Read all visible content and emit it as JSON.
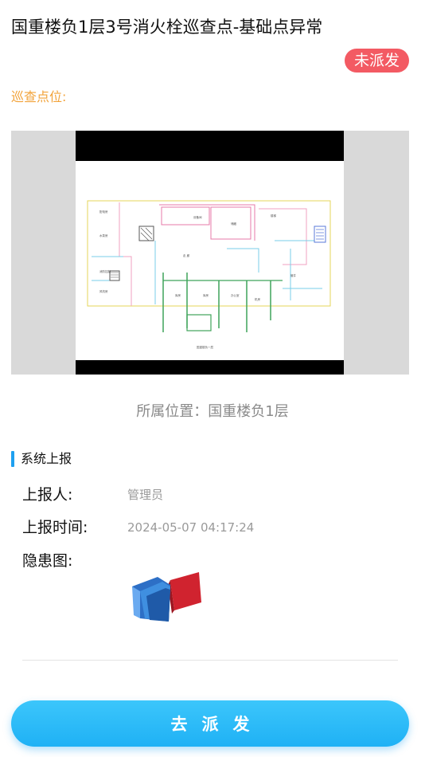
{
  "header": {
    "title": "国重楼负1层3号消火栓巡查点-基础点异常",
    "status_badge": "未派发"
  },
  "patrol": {
    "point_label": "巡查点位:",
    "location_line": "所属位置：国重楼负1层"
  },
  "report": {
    "section_title": "系统上报",
    "reporter_label": "上报人:",
    "reporter_value": "管理员",
    "time_label": "上报时间:",
    "time_value": "2024-05-07 04:17:24",
    "hazard_label": "隐患图:"
  },
  "actions": {
    "dispatch_label": "去派发"
  },
  "colors": {
    "status_badge_bg": "#f35a63",
    "accent_orange": "#f2a33a",
    "primary_blue": "#1fb1f5"
  },
  "icons": {
    "hazard_image": "open-book-icon"
  }
}
